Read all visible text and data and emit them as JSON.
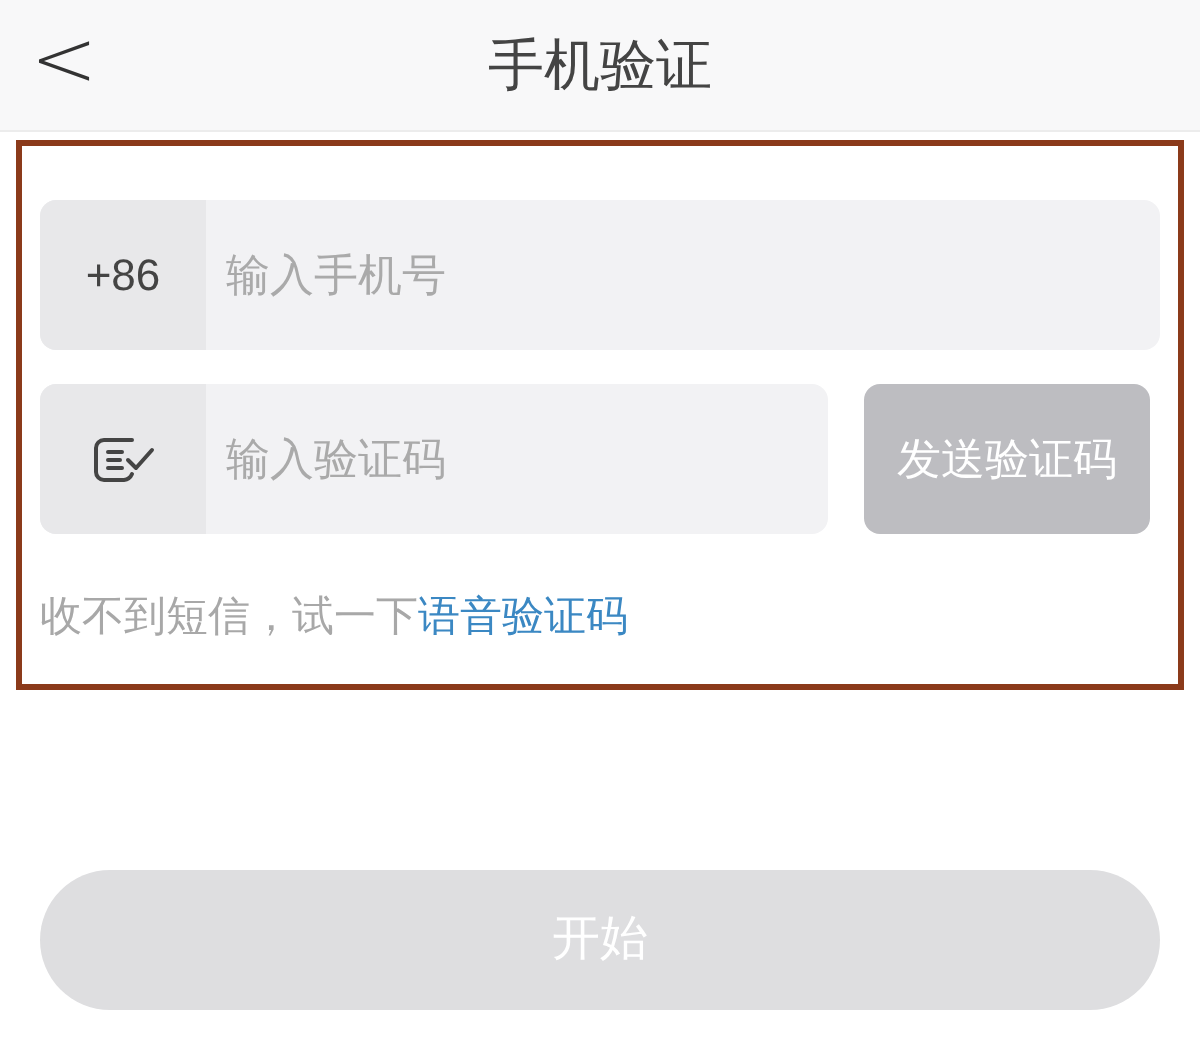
{
  "header": {
    "back": "<",
    "title": "手机验证"
  },
  "phone": {
    "prefix": "+86",
    "placeholder": "输入手机号"
  },
  "code": {
    "placeholder": "输入验证码",
    "send_button": {
      "label": "发送验证码",
      "disabled": true
    }
  },
  "hint": {
    "text": "收不到短信，试一下",
    "link": "语音验证码"
  },
  "start_button": {
    "label": "开始",
    "disabled": true
  }
}
